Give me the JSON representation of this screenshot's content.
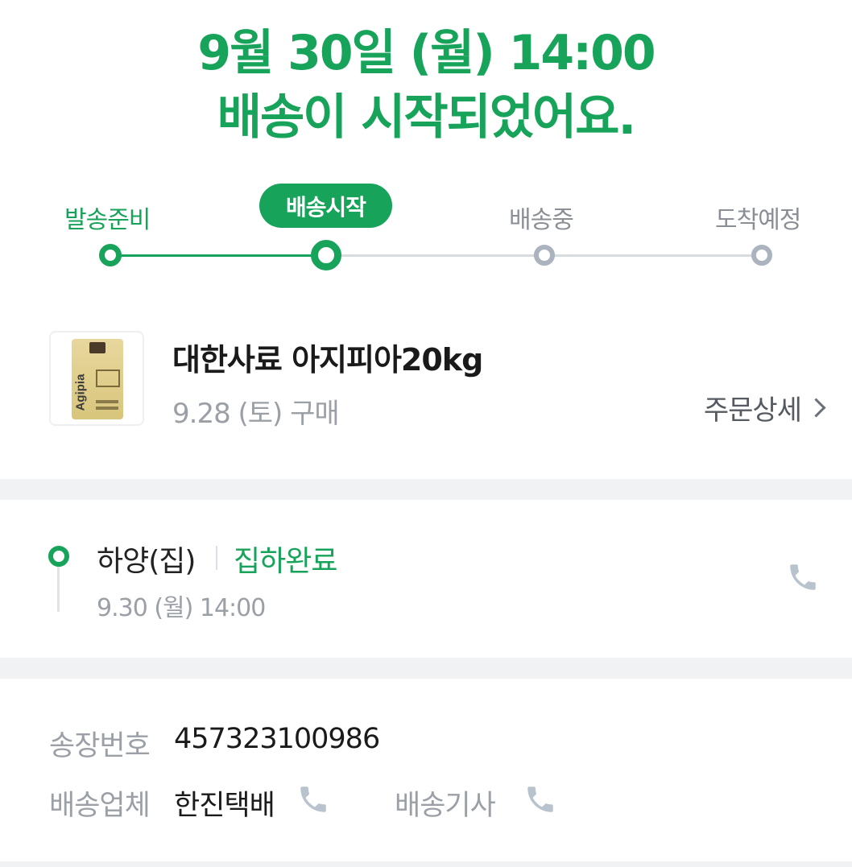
{
  "header": {
    "title_line1": "9월 30일 (월) 14:00",
    "title_line2": "배송이 시작되었어요."
  },
  "stepper": {
    "steps": [
      {
        "label": "발송준비",
        "state": "done"
      },
      {
        "label": "배송시작",
        "state": "current"
      },
      {
        "label": "배송중",
        "state": "pending"
      },
      {
        "label": "도착예정",
        "state": "pending"
      }
    ],
    "accent_color": "#17a35a",
    "pending_color": "#aab3be"
  },
  "product": {
    "name": "대한사료 아지피아20kg",
    "purchase_date": "9.28 (토) 구매",
    "thumbnail_brand": "Agipia",
    "order_detail_label": "주문상세"
  },
  "tracking": {
    "location": "하양(집)",
    "status": "집하완료",
    "time": "9.30 (월) 14:00",
    "phone_icon": "phone-icon"
  },
  "shipment": {
    "invoice_label": "송장번호",
    "invoice_number": "457323100986",
    "carrier_label": "배송업체",
    "carrier_name": "한진택배",
    "driver_label": "배송기사"
  }
}
